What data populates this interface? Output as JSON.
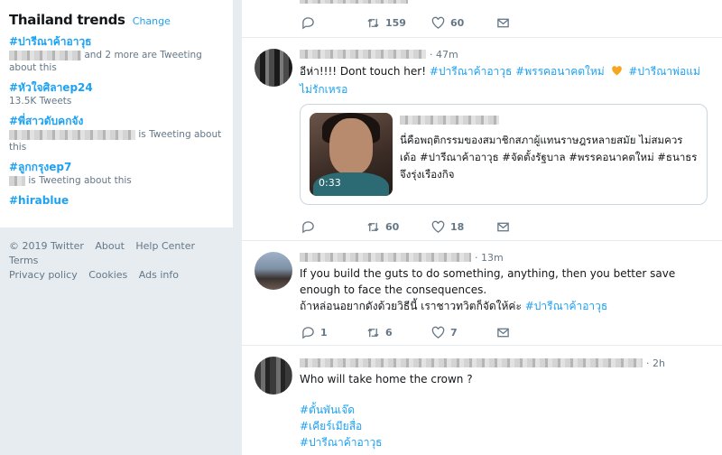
{
  "trends": {
    "title": "Thailand trends",
    "change": "Change",
    "items": [
      {
        "tag": "#ปารีณาค้าอาวุธ",
        "meta": "and 2 more are Tweeting about this"
      },
      {
        "tag": "#หัวใจศิลาep24",
        "meta": "13.5K Tweets"
      },
      {
        "tag": "#พี่สาวดับคกจัง",
        "meta": "is Tweeting about this"
      },
      {
        "tag": "#ลูกกรุงep7",
        "meta": "is Tweeting about this"
      },
      {
        "tag": "#hirablue",
        "meta": ""
      }
    ]
  },
  "footer": {
    "links": [
      "© 2019 Twitter",
      "About",
      "Help Center",
      "Terms",
      "Privacy policy",
      "Cookies",
      "Ads info"
    ]
  },
  "tweets": [
    {
      "retweets": "159",
      "likes": "60"
    },
    {
      "time": "· 47m",
      "text_plain": "อีห่า!!!! Dont touch her! ",
      "text_tags": "#ปารีณาค้าอาวุธ #พรรคอนาคตใหม่",
      "text_tags2": "#ปารีณาพ่อแม่ไม่รักเหรอ",
      "card_text_plain": "นี่คือพฤติกรรมของสมาชิกสภาผู้แทนราษฎรหลายสมัย ไม่สมควรเด้อ ",
      "card_text_tags": "#ปารีณาค้าอาวุธ #จัดตั้งรัฐบาล #พรรคอนาคตใหม่ #ธนาธรจึงรุ่งเรืองกิจ",
      "duration": "0:33",
      "replies": "",
      "retweets": "60",
      "likes": "18"
    },
    {
      "time": "· 13m",
      "text_line1": "If you build the guts to do something, anything, then you better save enough to face the consequences.",
      "text_line2": "ถ้าหล่อนอยากดังด้วยวิธีนี้ เราชาวทวิตก็จัดให้ค่ะ ",
      "text_tag": "#ปารีณาค้าอาวุธ",
      "replies": "1",
      "retweets": "6",
      "likes": "7"
    },
    {
      "time": "· 2h",
      "text": "Who will take home the crown ?",
      "tags": [
        "#ตั้นพันเจ๊ด",
        "#เคียร์เมียสื่อ",
        "#ปารีณาค้าอาวุธ"
      ]
    }
  ],
  "colors": {
    "accent": "#1da1f2",
    "heart": "#f5a623"
  }
}
